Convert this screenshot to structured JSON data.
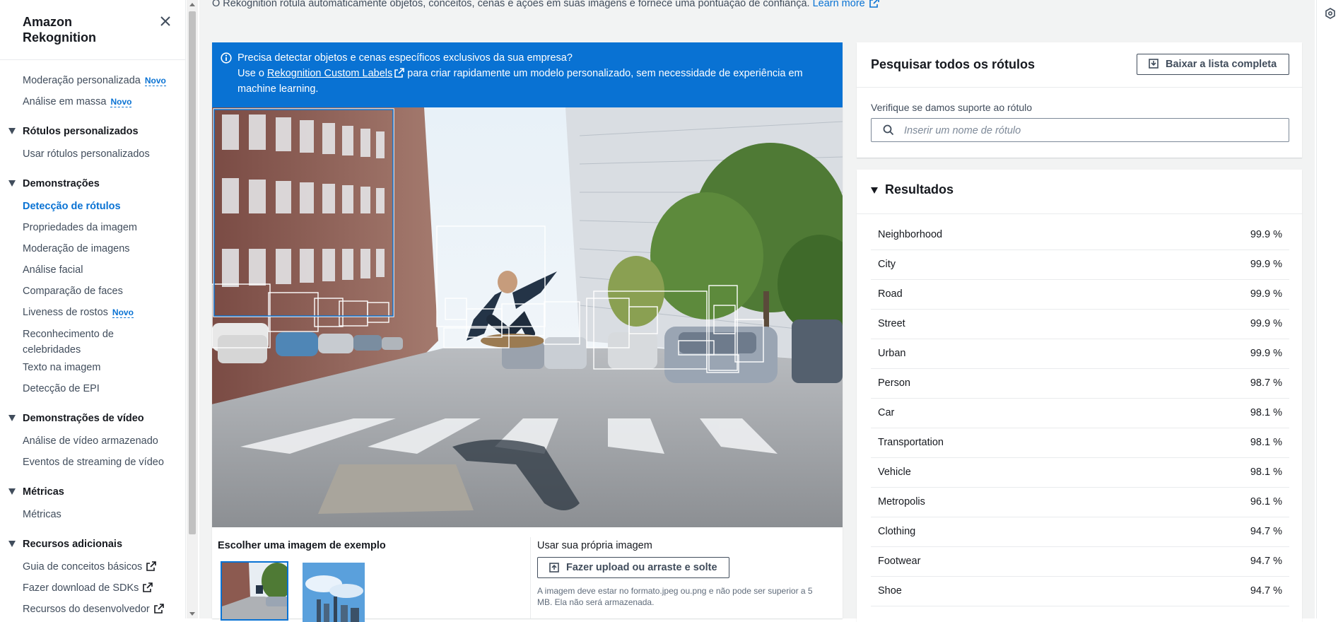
{
  "sidebar": {
    "title": "Amazon Rekognition",
    "items": [
      {
        "type": "item",
        "label": "Moderação personalizada",
        "badge": "Novo"
      },
      {
        "type": "item",
        "label": "Análise em massa",
        "badge": "Novo"
      },
      {
        "type": "section",
        "label": "Rótulos personalizados"
      },
      {
        "type": "item",
        "label": "Usar rótulos personalizados"
      },
      {
        "type": "section",
        "label": "Demonstrações"
      },
      {
        "type": "item",
        "label": "Detecção de rótulos",
        "active": true
      },
      {
        "type": "item",
        "label": "Propriedades da imagem"
      },
      {
        "type": "item",
        "label": "Moderação de imagens"
      },
      {
        "type": "item",
        "label": "Análise facial"
      },
      {
        "type": "item",
        "label": "Comparação de faces"
      },
      {
        "type": "item",
        "label": "Liveness de rostos",
        "badge": "Novo"
      },
      {
        "type": "item",
        "label": "Reconhecimento de celebridades",
        "multi": true
      },
      {
        "type": "item",
        "label": "Texto na imagem"
      },
      {
        "type": "item",
        "label": "Detecção de EPI"
      },
      {
        "type": "section",
        "label": "Demonstrações de vídeo"
      },
      {
        "type": "item",
        "label": "Análise de vídeo armazenado"
      },
      {
        "type": "item",
        "label": "Eventos de streaming de vídeo"
      },
      {
        "type": "section",
        "label": "Métricas"
      },
      {
        "type": "item",
        "label": "Métricas"
      },
      {
        "type": "section",
        "label": "Recursos adicionais"
      },
      {
        "type": "item",
        "label": "Guia de conceitos básicos",
        "external": true
      },
      {
        "type": "item",
        "label": "Fazer download de SDKs",
        "external": true
      },
      {
        "type": "item",
        "label": "Recursos do desenvolvedor",
        "external": true
      }
    ]
  },
  "header": {
    "description": "O Rekognition rotula automaticamente objetos, conceitos, cenas e ações em suas imagens e fornece uma pontuação de confiança.",
    "learn_more": "Learn more"
  },
  "banner": {
    "line1": "Precisa detectar objetos e cenas específicos exclusivos da sua empresa?",
    "use_prefix": "Use o",
    "link": "Rekognition Custom Labels",
    "suffix": "para criar rapidamente um modelo personalizado, sem necessidade de experiência em machine learning."
  },
  "sample": {
    "title": "Escolher uma imagem de exemplo"
  },
  "upload": {
    "title": "Usar sua própria imagem",
    "button": "Fazer upload ou arraste e solte",
    "note": "A imagem deve estar no formato.jpeg ou.png e não pode ser superior a 5 MB. Ela não será armazenada."
  },
  "search": {
    "title": "Pesquisar todos os rótulos",
    "download_button": "Baixar a lista completa",
    "label": "Verifique se damos suporte ao rótulo",
    "placeholder": "Inserir um nome de rótulo"
  },
  "results": {
    "title": "Resultados",
    "rows": [
      {
        "name": "Neighborhood",
        "confidence": "99.9 %"
      },
      {
        "name": "City",
        "confidence": "99.9 %"
      },
      {
        "name": "Road",
        "confidence": "99.9 %"
      },
      {
        "name": "Street",
        "confidence": "99.9 %"
      },
      {
        "name": "Urban",
        "confidence": "99.9 %"
      },
      {
        "name": "Person",
        "confidence": "98.7 %"
      },
      {
        "name": "Car",
        "confidence": "98.1 %"
      },
      {
        "name": "Transportation",
        "confidence": "98.1 %"
      },
      {
        "name": "Vehicle",
        "confidence": "98.1 %"
      },
      {
        "name": "Metropolis",
        "confidence": "96.1 %"
      },
      {
        "name": "Clothing",
        "confidence": "94.7 %"
      },
      {
        "name": "Footwear",
        "confidence": "94.7 %"
      },
      {
        "name": "Shoe",
        "confidence": "94.7 %"
      }
    ]
  },
  "colors": {
    "accent": "#0972d3",
    "banner": "#0972d3",
    "text": "#16191f",
    "secondary_text": "#414d5c"
  }
}
